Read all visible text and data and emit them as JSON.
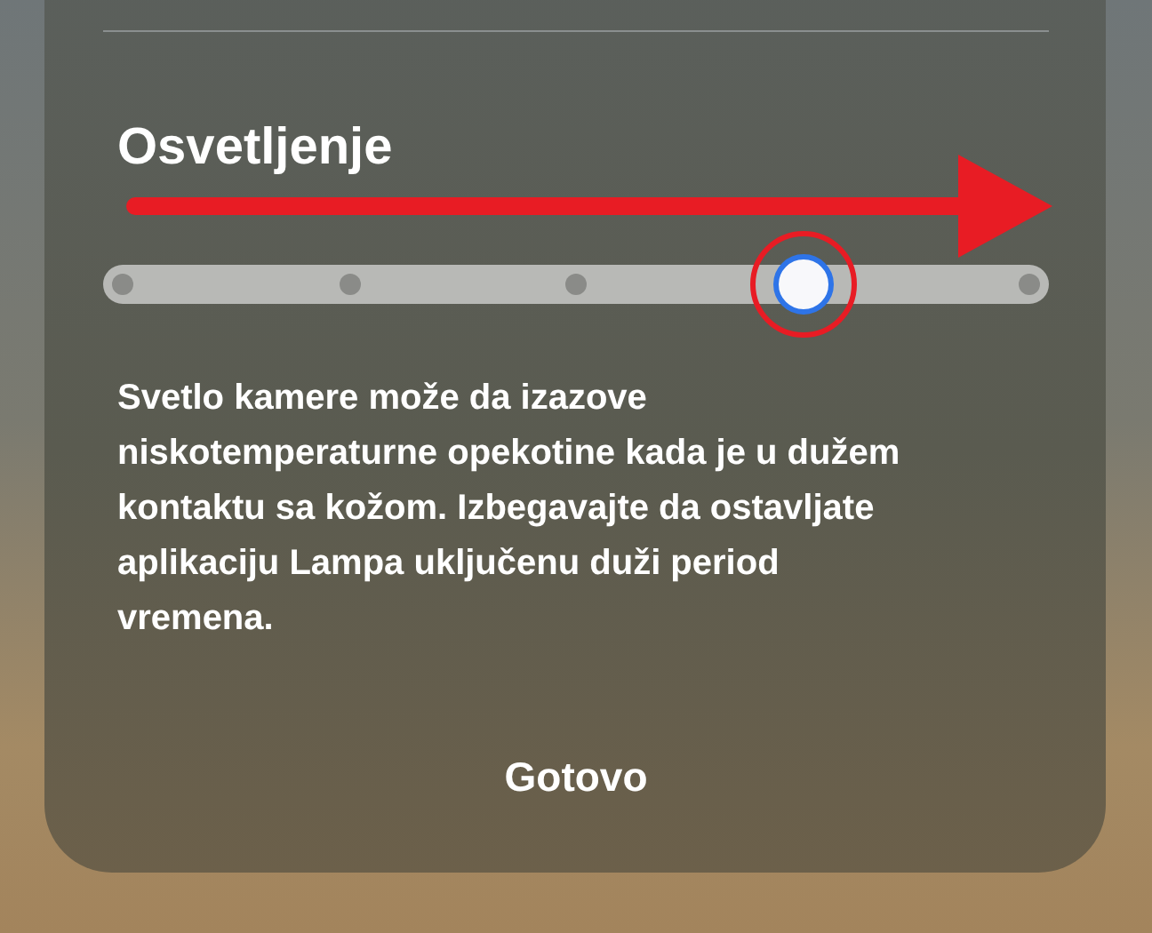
{
  "title": "Osvetljenje",
  "slider": {
    "level": 0.75
  },
  "annotations": {
    "arrow": true,
    "thumb_circle": true
  },
  "description": "Svetlo kamere može da izazove niskotemperaturne opekotine kada je u dužem kontaktu sa kožom. Izbegavajte da ostavljate aplikaciju Lampa uključenu duži period vremena.",
  "done_button": "Gotovo"
}
